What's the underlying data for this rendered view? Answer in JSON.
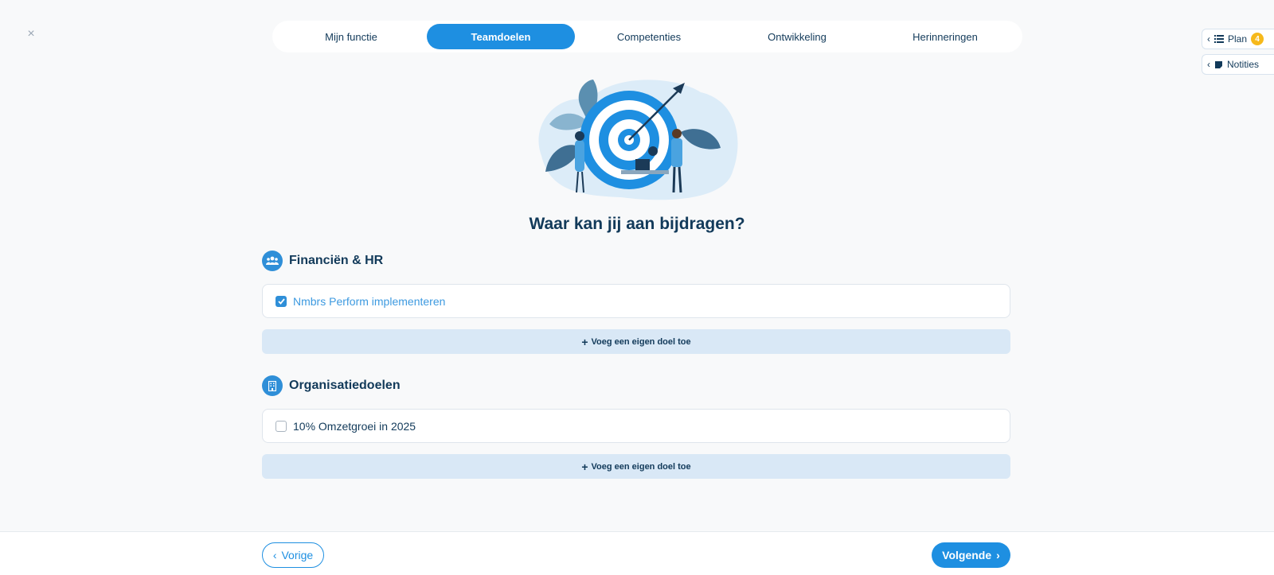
{
  "close": {
    "icon": "close-icon",
    "glyph": "×"
  },
  "tabs": [
    {
      "label": "Mijn functie",
      "active": false
    },
    {
      "label": "Teamdoelen",
      "active": true
    },
    {
      "label": "Competenties",
      "active": false
    },
    {
      "label": "Ontwikkeling",
      "active": false
    },
    {
      "label": "Herinneringen",
      "active": false
    }
  ],
  "side_panel": {
    "plan_label": "Plan",
    "plan_badge": "4",
    "notes_label": "Notities"
  },
  "heading": "Waar kan jij aan bijdragen?",
  "sections": [
    {
      "title": "Financiën & HR",
      "icon": "team-icon",
      "goals": [
        {
          "label": "Nmbrs Perform implementeren",
          "checked": true
        }
      ],
      "add_label": "Voeg een eigen doel toe"
    },
    {
      "title": "Organisatiedoelen",
      "icon": "building-icon",
      "goals": [
        {
          "label": "10% Omzetgroei in 2025",
          "checked": false
        }
      ],
      "add_label": "Voeg een eigen doel toe"
    }
  ],
  "footer": {
    "prev_label": "Vorige",
    "next_label": "Volgende"
  },
  "colors": {
    "accent": "#1e8fe1",
    "badge": "#f6b91b",
    "text": "#123a5a"
  }
}
